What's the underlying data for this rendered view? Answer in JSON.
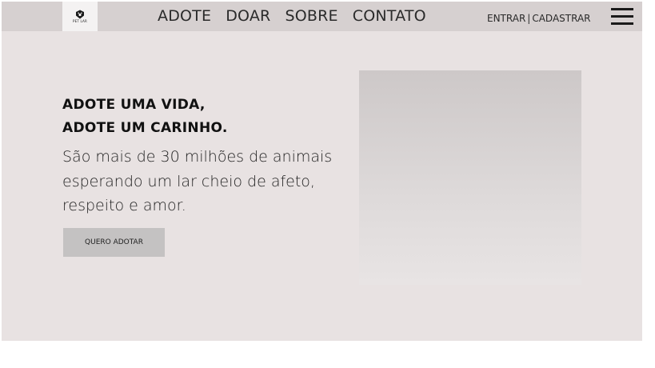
{
  "header": {
    "logo": {
      "icon": "paw-shield-icon",
      "text": "PET LAR"
    },
    "nav": [
      {
        "label": "ADOTE"
      },
      {
        "label": "DOAR"
      },
      {
        "label": "SOBRE"
      },
      {
        "label": "CONTATO"
      }
    ],
    "auth": {
      "login": "ENTRAR",
      "separator": "|",
      "signup": "CADASTRAR"
    },
    "menu_icon": "hamburger-menu-icon"
  },
  "hero": {
    "headline_line1": "ADOTE UMA VIDA,",
    "headline_line2": "ADOTE UM CARINHO.",
    "subtext": "São mais de 30 milhões de animais esperando um lar cheio de afeto, respeito e amor.",
    "cta_label": "QUERO ADOTAR",
    "image": "hero-image-placeholder"
  },
  "colors": {
    "background": "#e8e2e2",
    "topbar": "#d6d0d0",
    "button": "#c4c2c2",
    "text": "#111111"
  }
}
